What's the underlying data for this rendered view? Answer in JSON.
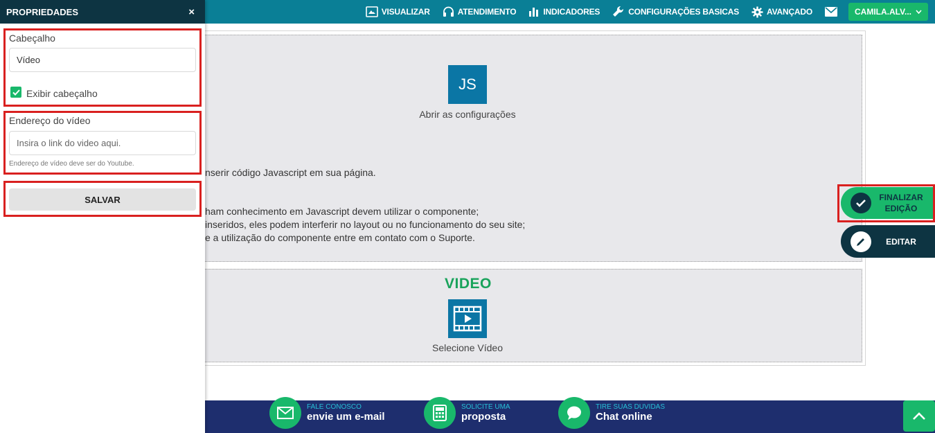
{
  "topnav": {
    "items": [
      {
        "label": "VISUALIZAR",
        "icon": "preview-icon"
      },
      {
        "label": "ATENDIMENTO",
        "icon": "headset-icon"
      },
      {
        "label": "INDICADORES",
        "icon": "bar-chart-icon"
      },
      {
        "label": "CONFIGURAÇÕES BASICAS",
        "icon": "wrench-icon"
      },
      {
        "label": "AVANÇADO",
        "icon": "gear-icon"
      }
    ],
    "mail_icon": "mail-icon",
    "user": "CAMILA.ALV..."
  },
  "panel": {
    "title": "PROPRIEDADES",
    "close": "×",
    "header_label": "Cabeçalho",
    "header_value": "Vídeo",
    "show_header_label": "Exibir cabeçalho",
    "show_header_checked": true,
    "video_url_label": "Endereço do vídeo",
    "video_url_placeholder": "Insira o link do video aqui.",
    "video_url_hint": "Endereço de vídeo deve ser do Youtube.",
    "save_label": "SALVAR"
  },
  "js_block": {
    "icon_text": "JS",
    "caption": "Abrir as configurações",
    "line1": "nserir código Javascript em sua página.",
    "line2": "ham conhecimento em Javascript devem utilizar o componente;",
    "line3": "inseridos, eles podem interferir no layout ou no funcionamento do seu site;",
    "line4": "e a utilização do componente entre em contato com o Suporte."
  },
  "video_block": {
    "title": "VIDEO",
    "caption": "Selecione Vídeo"
  },
  "floating": {
    "finish_label": "FINALIZAR EDIÇÃO",
    "edit_label": "EDITAR"
  },
  "footer": {
    "items": [
      {
        "small": "FALE CONOSCO",
        "big": "envie um e-mail",
        "icon": "mail-icon"
      },
      {
        "small": "SOLICITE UMA",
        "big": "proposta",
        "icon": "calculator-icon"
      },
      {
        "small": "TIRE SUAS DUVIDAS",
        "big": "Chat online",
        "icon": "chat-icon"
      }
    ],
    "back_to_top_icon": "chevron-up-icon"
  },
  "colors": {
    "topbar": "#0a7f96",
    "panel_header": "#0d3442",
    "accent_green": "#19b86b",
    "footer": "#1e2e6e",
    "highlight_red": "#d9201f"
  }
}
